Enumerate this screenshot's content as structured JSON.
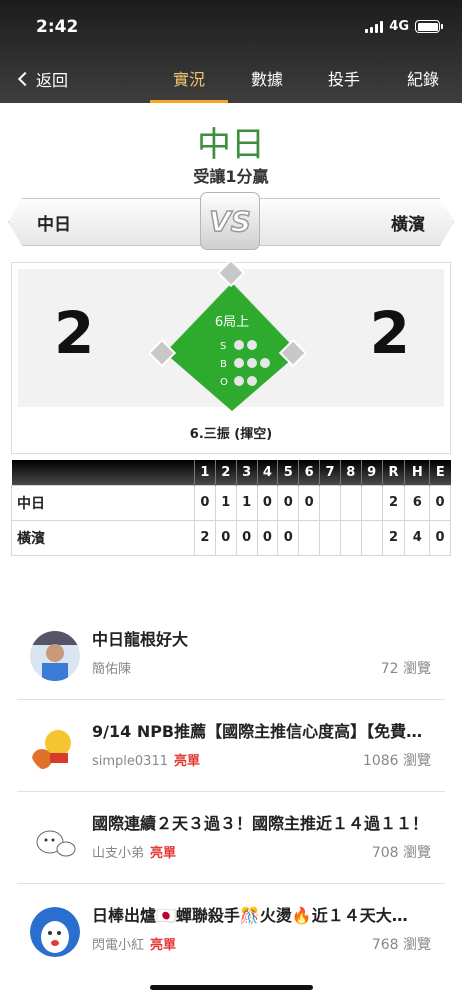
{
  "status": {
    "time": "2:42",
    "network": "4G"
  },
  "nav": {
    "back_label": "返回",
    "tabs": [
      {
        "label": "實況",
        "active": true
      },
      {
        "label": "數據",
        "active": false
      },
      {
        "label": "投手",
        "active": false
      },
      {
        "label": "紀錄",
        "active": false
      }
    ]
  },
  "game": {
    "leader": "中日",
    "leader_note": "受讓1分贏",
    "vs_label": "VS",
    "team_left": "中日",
    "team_right": "橫濱",
    "score_left": "2",
    "score_right": "2",
    "inning": "6局上",
    "count_labels": {
      "s": "S",
      "b": "B",
      "o": "O"
    },
    "count": {
      "strikes": 2,
      "balls": 3,
      "outs": 2
    },
    "last_play": "6.三振 (揮空)"
  },
  "linescore": {
    "headers": [
      "1",
      "2",
      "3",
      "4",
      "5",
      "6",
      "7",
      "8",
      "9",
      "R",
      "H",
      "E"
    ],
    "rows": [
      {
        "team": "中日",
        "cells": [
          "0",
          "1",
          "1",
          "0",
          "0",
          "0",
          "",
          "",
          "",
          "2",
          "6",
          "0"
        ]
      },
      {
        "team": "橫濱",
        "cells": [
          "2",
          "0",
          "0",
          "0",
          "0",
          "",
          "",
          "",
          "",
          "2",
          "4",
          "0"
        ]
      }
    ]
  },
  "posts": [
    {
      "title": "中日龍根好大",
      "author": "簡佑陳",
      "badge": "",
      "views": "72 瀏覽"
    },
    {
      "title": "9/14 NPB推薦【國際主推信心度高】【免費…",
      "author": "simple0311",
      "badge": "亮單",
      "views": "1086 瀏覽"
    },
    {
      "title": "國際連續２天３過３！國際主推近１４過１１！",
      "author": "山支小弟",
      "badge": "亮單",
      "views": "708 瀏覽"
    },
    {
      "title": "日棒出爐🇯🇵蟬聯殺手🎊火燙🔥近１４天大…",
      "author": "閃電小紅",
      "badge": "亮單",
      "views": "768 瀏覽"
    }
  ],
  "colors": {
    "accent": "#f5a623",
    "leader_green": "#3e8e3e",
    "field_green": "#2eaa2e",
    "hot_red": "#e53935"
  }
}
